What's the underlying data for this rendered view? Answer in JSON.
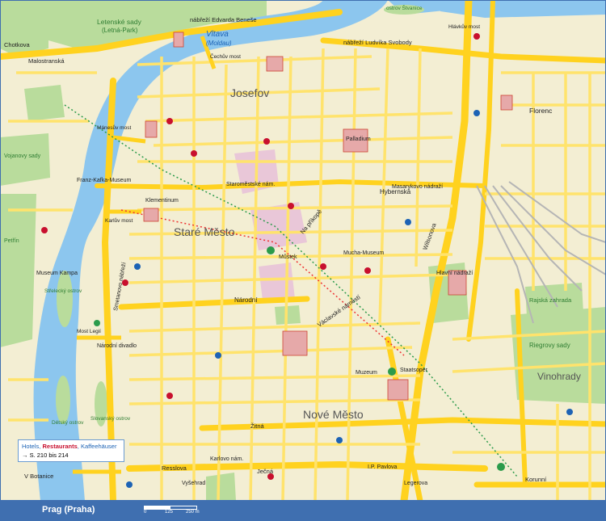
{
  "map": {
    "title": "Prag (Praha)",
    "scale": {
      "zero": "0",
      "mid": "125",
      "end": "250 m"
    },
    "legend": {
      "line1_a": "Hotels, ",
      "line1_b": "Restaurants",
      "line1_c": ", Kaffeehäuser",
      "line2": "→ S. 210 bis 214"
    },
    "colors": {
      "water": "#8cc6ee",
      "park": "#b9dc9c",
      "road": "#ffe36c",
      "major_road": "#ffd21f",
      "block": "#f3eed3",
      "pedestrian": "#e9c7d8",
      "frame": "#3f6fb0"
    },
    "labels": {
      "letenske_sady": "Letenské sady",
      "letna_park": "(Letná-Park)",
      "vltava": "Vltava",
      "moldau": "(Moldau)",
      "chotkova": "Chotkova",
      "malostranska": "Malostranská",
      "nabrezi_benese": "nábřeží Edvarda Beneše",
      "nabrezi_svobody": "nábřeží Ludvíka Svobody",
      "josefov": "Josefov",
      "stare_mesto": "Staré Město",
      "nove_mesto": "Nové Město",
      "vinohrady": "Vinohrady",
      "florenc": "Florenc",
      "hybernska": "Hybernská",
      "narodni": "Národní",
      "vaclavske": "Václavské náměstí",
      "wilsonova": "Wilsonova",
      "rieger": "Riegrovy sady",
      "rajska": "Rajská zahrada",
      "strelecky": "Střelecký ostrov",
      "kampa": "Museum Kampa",
      "vojanovy": "Vojanovy sady",
      "petrin": "Petřín",
      "staroměstske": "Staroměstské nám.",
      "prikopy": "Na příkopě",
      "hlavni": "Hlavní nádraží",
      "muzeum": "Muzeum",
      "mustek": "Můstek",
      "karlovo": "Karlovo nám.",
      "vysehrad": "Vyšehrad",
      "botanice": "V Botanice",
      "jecna": "Ječná",
      "resslova": "Resslova",
      "zitna": "Žitná",
      "legerova": "Legerova",
      "slovansky": "Slovanský ostrov",
      "detsky": "Dětský ostrov",
      "narodni_divadlo": "Národní divadlo",
      "kafka": "Franz-Kafka-Museum",
      "palladium": "Palladium",
      "masaryk": "Masarykovo nádraží",
      "staatsoper": "Staatsoper",
      "mucha": "Mucha-Museum",
      "karlsbrucke": "Karlův most",
      "legie": "Most Legií",
      "manes": "Mánesův most",
      "cechuv": "Čechův most",
      "hlavkuv": "Hlávkův most",
      "stvanice": "ostrov Štvanice",
      "klementinum": "Klementinum",
      "pavlova": "I.P. Pavlova",
      "smetanovo": "Smetanovo nábřeží",
      "korunni": "Korunní"
    }
  }
}
